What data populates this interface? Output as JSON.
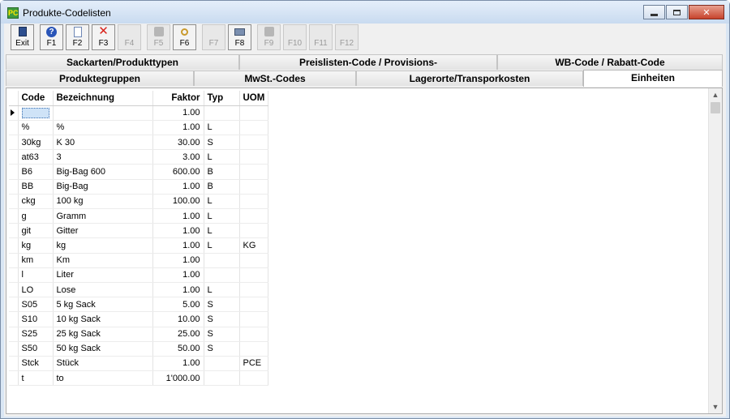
{
  "window": {
    "title": "Produkte-Codelisten",
    "app_icon_glyph": "PC"
  },
  "toolbar": [
    {
      "label": "Exit",
      "icon": "exit-door-icon",
      "enabled": true
    },
    {
      "label": "F1",
      "icon": "help-icon",
      "enabled": true
    },
    {
      "label": "F2",
      "icon": "new-page-icon",
      "enabled": true
    },
    {
      "label": "F3",
      "icon": "delete-x-icon",
      "enabled": true
    },
    {
      "label": "F4",
      "icon": "",
      "enabled": false
    },
    {
      "label": "F5",
      "icon": "grey-tool-icon",
      "enabled": false
    },
    {
      "label": "F6",
      "icon": "search-icon",
      "enabled": true
    },
    {
      "label": "F7",
      "icon": "",
      "enabled": false
    },
    {
      "label": "F8",
      "icon": "print-icon",
      "enabled": true
    },
    {
      "label": "F9",
      "icon": "grey-tool-icon",
      "enabled": false
    },
    {
      "label": "F10",
      "icon": "",
      "enabled": false
    },
    {
      "label": "F11",
      "icon": "",
      "enabled": false
    },
    {
      "label": "F12",
      "icon": "",
      "enabled": false
    }
  ],
  "tabs_row1": [
    "Sackarten/Produkttypen",
    "Preislisten-Code / Provisions-",
    "WB-Code / Rabatt-Code"
  ],
  "tabs_row2": [
    "Produktegruppen",
    "MwSt.-Codes",
    "Lagerorte/Transporkosten",
    "Einheiten"
  ],
  "active_tab": "Einheiten",
  "grid": {
    "columns": [
      "Code",
      "Bezeichnung",
      "Faktor",
      "Typ",
      "UOM"
    ],
    "rows": [
      [
        "",
        "",
        "1.00",
        "",
        ""
      ],
      [
        "%",
        "%",
        "1.00",
        "L",
        ""
      ],
      [
        "30kg",
        "K 30",
        "30.00",
        "S",
        ""
      ],
      [
        "at63",
        "3",
        "3.00",
        "L",
        ""
      ],
      [
        "B6",
        "Big-Bag 600",
        "600.00",
        "B",
        ""
      ],
      [
        "BB",
        "Big-Bag",
        "1.00",
        "B",
        ""
      ],
      [
        "ckg",
        "100 kg",
        "100.00",
        "L",
        ""
      ],
      [
        "g",
        "Gramm",
        "1.00",
        "L",
        ""
      ],
      [
        "git",
        "Gitter",
        "1.00",
        "L",
        ""
      ],
      [
        "kg",
        "kg",
        "1.00",
        "L",
        "KG"
      ],
      [
        "km",
        "Km",
        "1.00",
        "",
        ""
      ],
      [
        "l",
        "Liter",
        "1.00",
        "",
        ""
      ],
      [
        "LO",
        "Lose",
        "1.00",
        "L",
        ""
      ],
      [
        "S05",
        "5 kg Sack",
        "5.00",
        "S",
        ""
      ],
      [
        "S10",
        "10 kg Sack",
        "10.00",
        "S",
        ""
      ],
      [
        "S25",
        "25 kg Sack",
        "25.00",
        "S",
        ""
      ],
      [
        "S50",
        "50 kg Sack",
        "50.00",
        "S",
        ""
      ],
      [
        "Stck",
        "Stück",
        "1.00",
        "",
        "PCE"
      ],
      [
        "t",
        "to",
        "1'000.00",
        "",
        ""
      ]
    ]
  },
  "scrollbar": {
    "up_glyph": "▲",
    "down_glyph": "▼"
  }
}
